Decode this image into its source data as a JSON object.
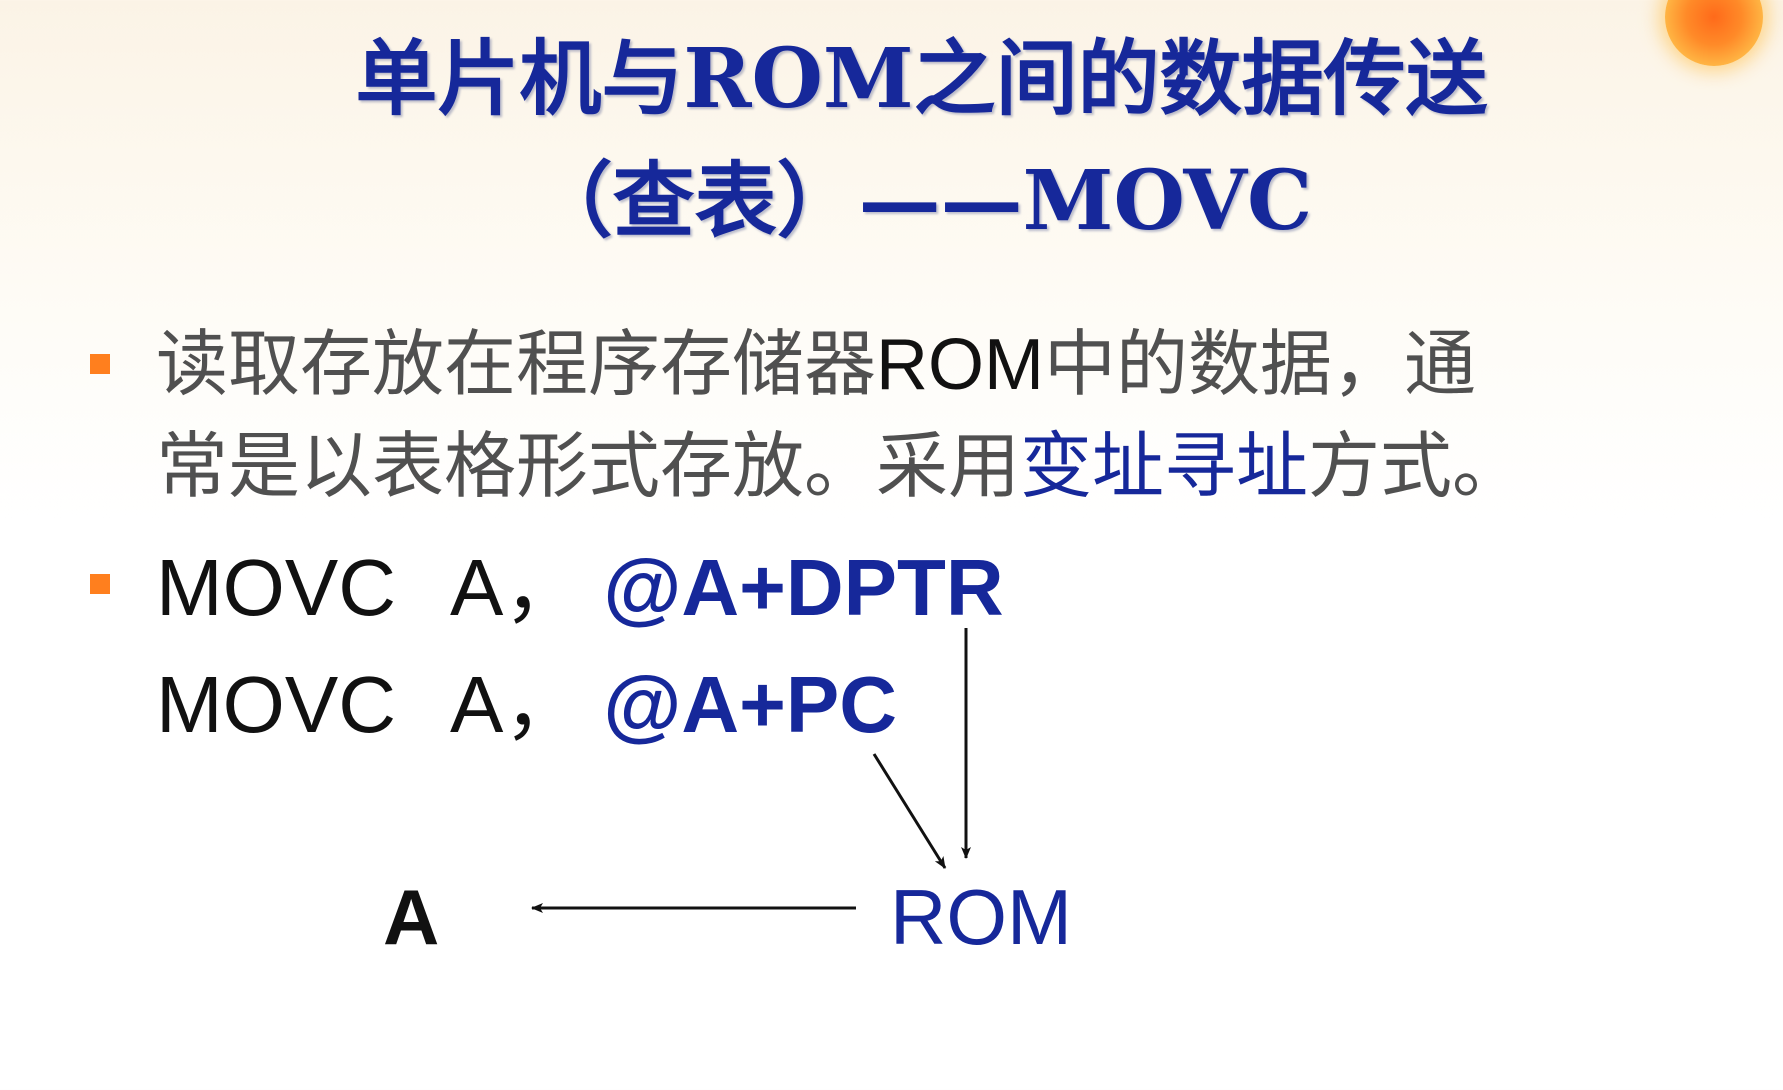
{
  "title": {
    "line1": "单片机与ROM之间的数据传送",
    "line2": "（查表）——MOVC"
  },
  "bullets": [
    {
      "line1_a": "读取存放在程序存储器",
      "line1_b": "ROM",
      "line1_c": "中的数据，通",
      "line2_a": "常是以表格形式存放。采用",
      "line2_b": "变址寻址",
      "line2_c": "方式。"
    },
    {
      "instructions": [
        {
          "mnemonic": "MOVC",
          "register": "A，",
          "operand": "@A+DPTR"
        },
        {
          "mnemonic": "MOVC",
          "register": "A，",
          "operand": "@A+PC"
        }
      ]
    }
  ],
  "diagram": {
    "target": "A",
    "source": "ROM"
  },
  "colors": {
    "title": "#16289a",
    "highlight": "#16289a",
    "bullet": "#ff7f1e",
    "sun": "#ff6a1a"
  }
}
